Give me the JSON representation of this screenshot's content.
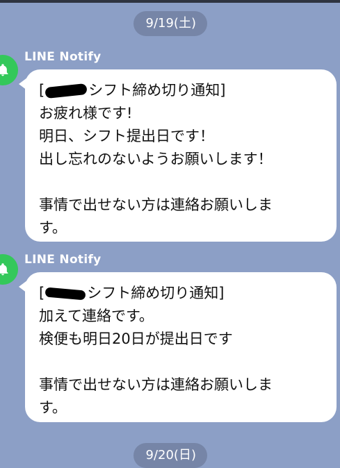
{
  "dates": {
    "top": "9/19(土)",
    "bottom": "9/20(日)"
  },
  "messages": [
    {
      "sender": "LINE Notify",
      "lines": [
        [
          "[",
          "シフト締め切り通知]"
        ],
        "お疲れ様です!",
        "明日、シフト提出日です！",
        "出し忘れのないようお願いします！",
        "",
        "事情で出せない方は連絡お願いしま",
        "す。"
      ],
      "redacted_token": true
    },
    {
      "sender": "LINE Notify",
      "lines": [
        [
          "[",
          "シフト締め切り通知]"
        ],
        "加えて連絡です。",
        "検便も明日20日が提出日です",
        "",
        "事情で出せない方は連絡お願いしま",
        "す。"
      ],
      "redacted_token": true
    }
  ],
  "icons": {
    "avatar": "bell-icon"
  },
  "colors": {
    "background": "#8c9fc6",
    "bubble": "#ffffff",
    "avatar": "#34c85a",
    "text": "#111111",
    "sender": "#ffffff"
  }
}
